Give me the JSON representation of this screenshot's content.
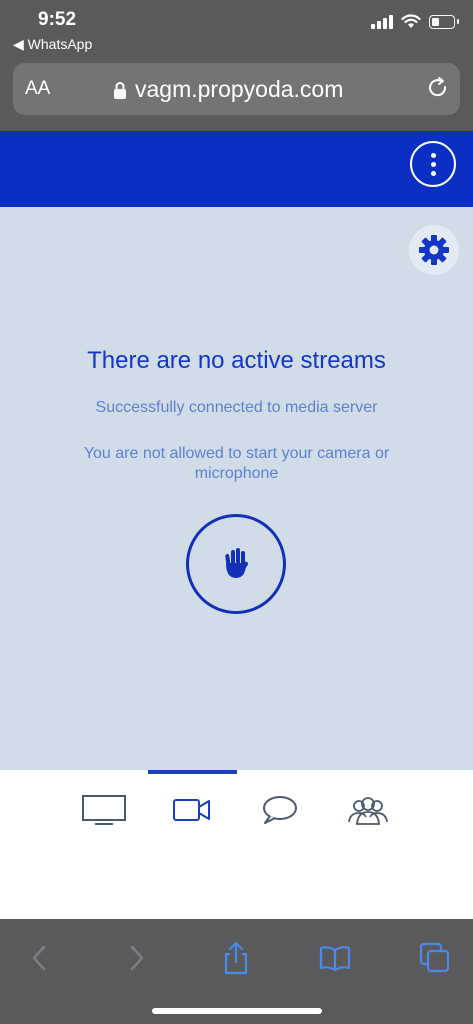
{
  "status_bar": {
    "time": "9:52",
    "back_app": "◀ WhatsApp"
  },
  "browser": {
    "text_size_label": "AA",
    "url": "vagm.propyoda.com"
  },
  "stage": {
    "title": "There are no active streams",
    "subtitle": "Successfully connected to media server",
    "permission_message": "You are not allowed to start your camera or microphone"
  },
  "tabs": [
    {
      "name": "screen",
      "icon": "monitor-icon"
    },
    {
      "name": "video",
      "icon": "video-camera-icon",
      "active": true
    },
    {
      "name": "chat",
      "icon": "chat-bubble-icon"
    },
    {
      "name": "participants",
      "icon": "people-icon"
    }
  ],
  "colors": {
    "header_blue": "#0a2fc2",
    "stage_bg": "#d0dde9",
    "accent": "#1436c8",
    "safari_gray": "#5a5a5c"
  }
}
